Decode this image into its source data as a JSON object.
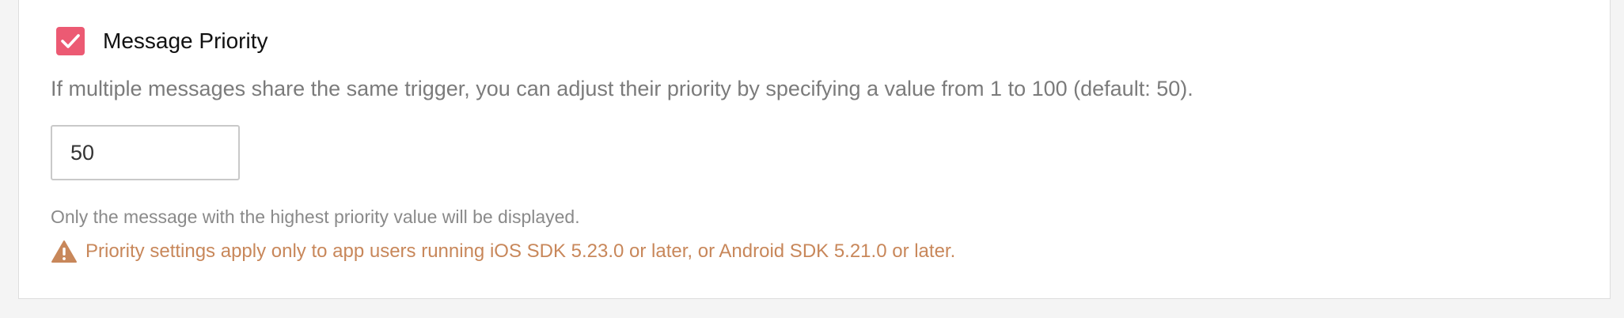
{
  "message_priority": {
    "checkbox_label": "Message Priority",
    "checked": true,
    "description": "If multiple messages share the same trigger, you can adjust their priority by specifying a value from 1 to 100 (default: 50).",
    "value": "50",
    "note": "Only the message with the highest priority value will be displayed.",
    "warning": "Priority settings apply only to app users running iOS SDK 5.23.0 or later, or Android SDK 5.21.0 or later."
  },
  "icons": {
    "checkbox": "check-icon",
    "warning": "warning-triangle-icon"
  },
  "colors": {
    "accent": "#ec5a73",
    "warning": "#c8875a",
    "muted_text": "#7b7b7b"
  }
}
